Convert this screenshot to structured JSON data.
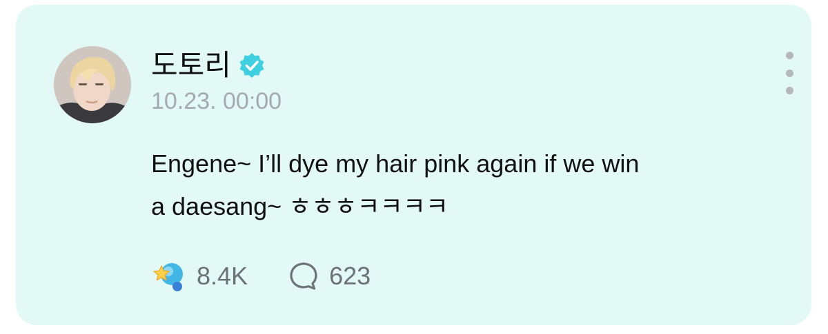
{
  "post": {
    "author": "도토리",
    "timestamp": "10.23. 00:00",
    "body_line1": "Engene~ I’ll dye my hair pink again if we win",
    "body_line2_text": "a daesang~ ",
    "body_line2_korean": "ㅎㅎㅎㅋㅋㅋㅋ",
    "reaction_count": "8.4K",
    "comment_count": "623"
  },
  "icons": {
    "avatar": "avatar",
    "verified": "verified-check-icon",
    "more": "more-vertical-icon",
    "cheer": "cheer-icon",
    "comment": "comment-bubble-icon"
  },
  "colors": {
    "card_background": "#e3f9f6",
    "verified": "#3ecfe0",
    "text_primary": "#111111",
    "text_secondary": "#a3aaad",
    "count_text": "#6b7275"
  }
}
